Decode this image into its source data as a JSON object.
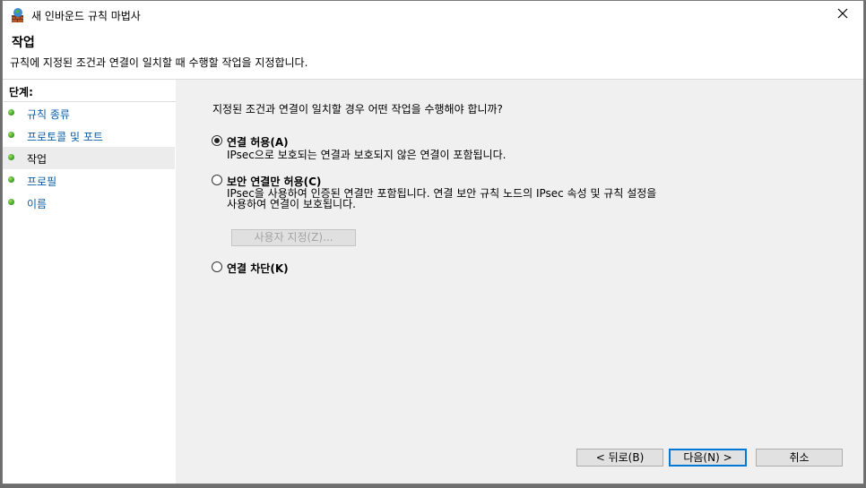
{
  "window": {
    "title": "새 인바운드 규칙 마법사",
    "close_glyph": "✕"
  },
  "header": {
    "title": "작업",
    "description": "규칙에 지정된 조건과 연결이 일치할 때 수행할 작업을 지정합니다."
  },
  "steps": {
    "title": "단계:",
    "items": [
      {
        "label": "규칙 종류",
        "current": false
      },
      {
        "label": "프로토콜 및 포트",
        "current": false
      },
      {
        "label": "작업",
        "current": true
      },
      {
        "label": "프로필",
        "current": false
      },
      {
        "label": "이름",
        "current": false
      }
    ]
  },
  "content": {
    "question": "지정된 조건과 연결이 일치할 경우 어떤 작업을 수행해야 합니까?",
    "options": [
      {
        "label": "연결 허용(A)",
        "checked": true,
        "description": [
          "IPsec으로 보호되는 연결과 보호되지 않은 연결이 포함됩니다."
        ]
      },
      {
        "label": "보안 연결만 허용(C)",
        "checked": false,
        "description": [
          "IPsec을 사용하여 인증된 연결만 포함됩니다. 연결 보안 규칙 노드의 IPsec 속성 및 규칙 설정을",
          "사용하여 연결이 보호됩니다."
        ]
      },
      {
        "label": "연결 차단(K)",
        "checked": false,
        "description": []
      }
    ],
    "customize_button": "사용자 지정(Z)..."
  },
  "footer": {
    "back_button": "< 뒤로(B)",
    "next_button": "다음(N) >",
    "cancel_button": "취소"
  },
  "colors": {
    "link": "#0b5ea8",
    "step_dot": "#3fa523",
    "default_button_border": "#0078d7"
  },
  "icons": [
    "firewall-wizard-icon",
    "close-icon",
    "step-status-icon",
    "radio-button"
  ]
}
